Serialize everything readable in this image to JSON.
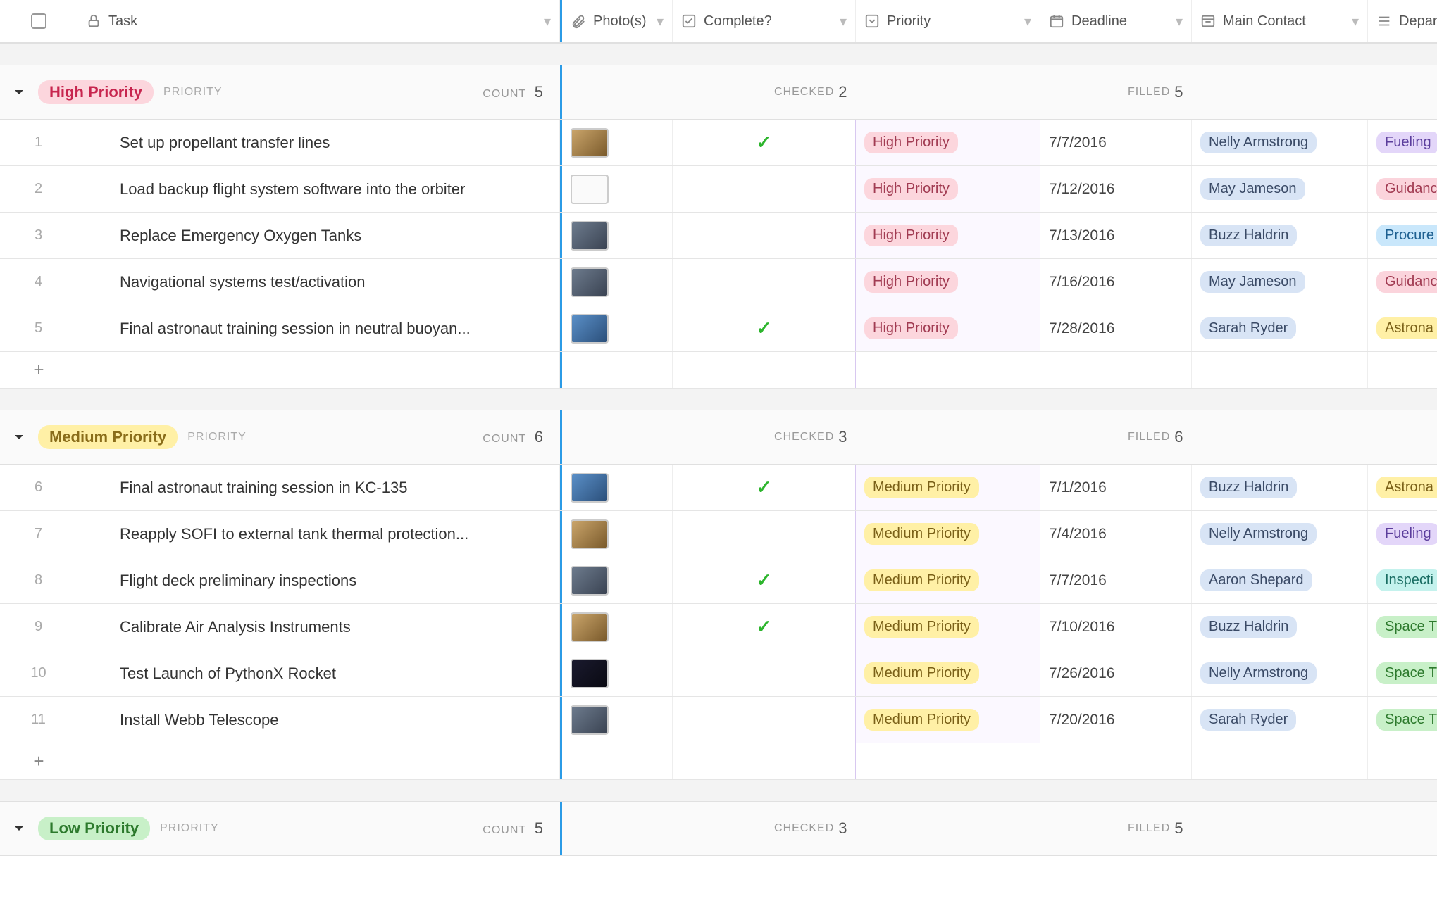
{
  "header": {
    "task": "Task",
    "photo": "Photo(s)",
    "complete": "Complete?",
    "priority": "Priority",
    "deadline": "Deadline",
    "contact": "Main Contact",
    "dept": "Depar"
  },
  "groups": [
    {
      "name": "High Priority",
      "pill_class": "pill-high",
      "sublabel": "PRIORITY",
      "count_label": "COUNT",
      "count": "5",
      "checked_label": "CHECKED",
      "checked": "2",
      "filled_label": "FILLED",
      "filled": "5",
      "rows": [
        {
          "num": "1",
          "task": "Set up propellant transfer lines",
          "thumb": "warm",
          "complete": true,
          "priority": "High Priority",
          "deadline": "7/7/2016",
          "contact": "Nelly Armstrong",
          "dept": "Fueling",
          "dept_class": "tag-dept-fueling"
        },
        {
          "num": "2",
          "task": "Load backup flight system software into the orbiter",
          "thumb": "light",
          "complete": false,
          "priority": "High Priority",
          "deadline": "7/12/2016",
          "contact": "May Jameson",
          "dept": "Guidanc",
          "dept_class": "tag-dept-guidance"
        },
        {
          "num": "3",
          "task": "Replace Emergency Oxygen Tanks",
          "thumb": "",
          "complete": false,
          "priority": "High Priority",
          "deadline": "7/13/2016",
          "contact": "Buzz Haldrin",
          "dept": "Procure",
          "dept_class": "tag-dept-procure"
        },
        {
          "num": "4",
          "task": "Navigational systems test/activation",
          "thumb": "",
          "complete": false,
          "priority": "High Priority",
          "deadline": "7/16/2016",
          "contact": "May Jameson",
          "dept": "Guidanc",
          "dept_class": "tag-dept-guidance"
        },
        {
          "num": "5",
          "task": "Final astronaut training session in neutral buoyan...",
          "thumb": "blue",
          "complete": true,
          "priority": "High Priority",
          "deadline": "7/28/2016",
          "contact": "Sarah Ryder",
          "dept": "Astrona",
          "dept_class": "tag-dept-astrona"
        }
      ]
    },
    {
      "name": "Medium Priority",
      "pill_class": "pill-medium",
      "sublabel": "PRIORITY",
      "count_label": "COUNT",
      "count": "6",
      "checked_label": "CHECKED",
      "checked": "3",
      "filled_label": "FILLED",
      "filled": "6",
      "rows": [
        {
          "num": "6",
          "task": "Final astronaut training session in KC-135",
          "thumb": "blue",
          "complete": true,
          "priority": "Medium Priority",
          "deadline": "7/1/2016",
          "contact": "Buzz Haldrin",
          "dept": "Astrona",
          "dept_class": "tag-dept-astrona"
        },
        {
          "num": "7",
          "task": "Reapply SOFI to external tank thermal protection...",
          "thumb": "warm",
          "complete": false,
          "priority": "Medium Priority",
          "deadline": "7/4/2016",
          "contact": "Nelly Armstrong",
          "dept": "Fueling",
          "dept_class": "tag-dept-fueling"
        },
        {
          "num": "8",
          "task": "Flight deck preliminary inspections",
          "thumb": "",
          "complete": true,
          "priority": "Medium Priority",
          "deadline": "7/7/2016",
          "contact": "Aaron Shepard",
          "dept": "Inspecti",
          "dept_class": "tag-dept-inspect"
        },
        {
          "num": "9",
          "task": "Calibrate Air Analysis Instruments",
          "thumb": "warm",
          "complete": true,
          "priority": "Medium Priority",
          "deadline": "7/10/2016",
          "contact": "Buzz Haldrin",
          "dept": "Space T",
          "dept_class": "tag-dept-space"
        },
        {
          "num": "10",
          "task": "Test Launch of PythonX Rocket",
          "thumb": "night",
          "complete": false,
          "priority": "Medium Priority",
          "deadline": "7/26/2016",
          "contact": "Nelly Armstrong",
          "dept": "Space T",
          "dept_class": "tag-dept-space"
        },
        {
          "num": "11",
          "task": "Install Webb Telescope",
          "thumb": "",
          "complete": false,
          "priority": "Medium Priority",
          "deadline": "7/20/2016",
          "contact": "Sarah Ryder",
          "dept": "Space T",
          "dept_class": "tag-dept-space"
        }
      ]
    },
    {
      "name": "Low Priority",
      "pill_class": "pill-low",
      "sublabel": "PRIORITY",
      "count_label": "COUNT",
      "count": "5",
      "checked_label": "CHECKED",
      "checked": "3",
      "filled_label": "FILLED",
      "filled": "5",
      "rows": []
    }
  ]
}
